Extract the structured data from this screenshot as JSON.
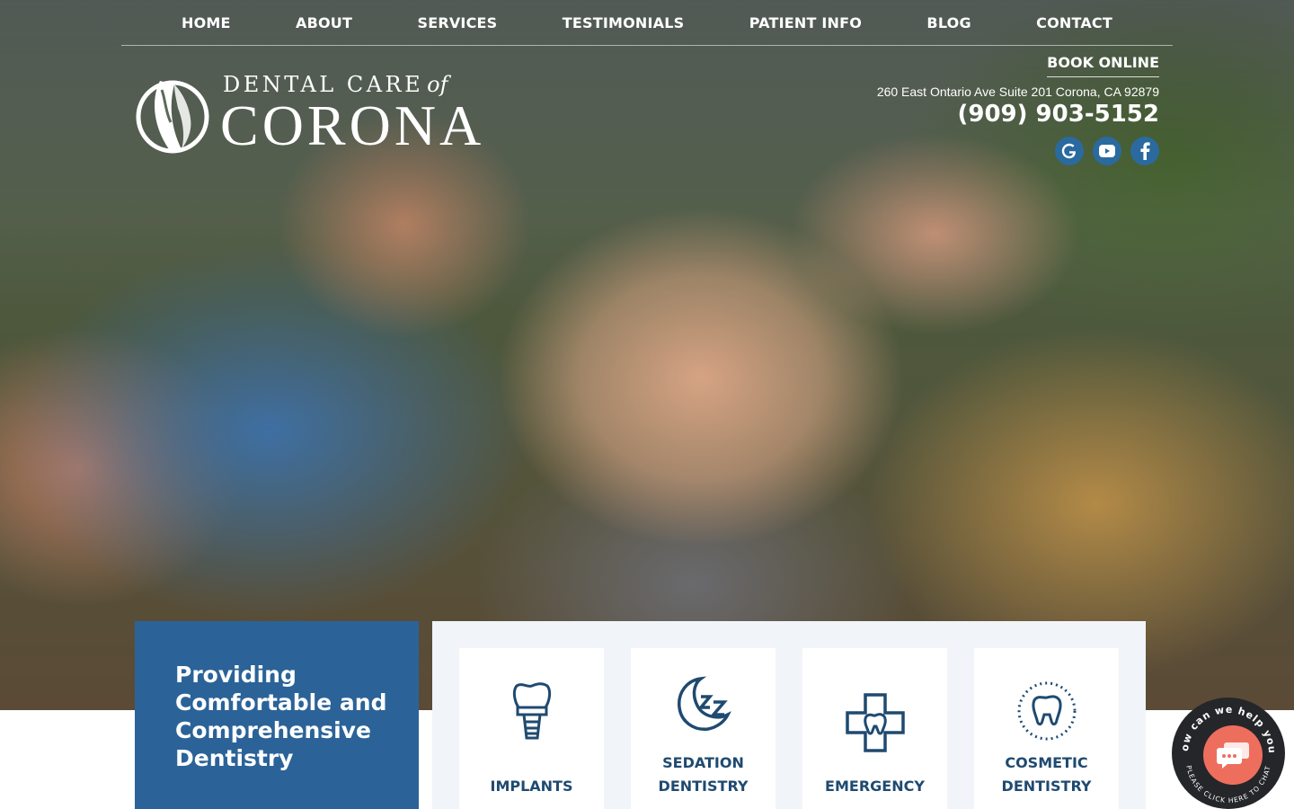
{
  "nav": {
    "items": [
      "HOME",
      "ABOUT",
      "SERVICES",
      "TESTIMONIALS",
      "PATIENT INFO",
      "BLOG",
      "CONTACT"
    ]
  },
  "logo": {
    "line1": "DENTAL CARE",
    "of": "of",
    "line2": "CORONA"
  },
  "contact": {
    "book_label": "BOOK ONLINE",
    "address": "260 East Ontario Ave Suite 201 Corona, CA 92879",
    "phone": "(909) 903-5152",
    "socials": [
      "google-icon",
      "youtube-icon",
      "facebook-icon"
    ]
  },
  "tagline": {
    "text": "Providing Comfortable and Comprehensive Dentistry"
  },
  "services": [
    {
      "icon": "implant-icon",
      "label": "IMPLANTS"
    },
    {
      "icon": "sleep-icon",
      "label": "SEDATION DENTISTRY"
    },
    {
      "icon": "emergency-cross-tooth-icon",
      "label": "EMERGENCY"
    },
    {
      "icon": "sparkle-tooth-icon",
      "label": "COSMETIC DENTISTRY"
    }
  ],
  "chat": {
    "top_text": "How can we help you?",
    "bottom_text": "PLEASE CLICK HERE TO CHAT"
  },
  "colors": {
    "brand_blue": "#2b6398",
    "icon_blue": "#1f4a70",
    "chat_coral": "#ee6e5e"
  }
}
